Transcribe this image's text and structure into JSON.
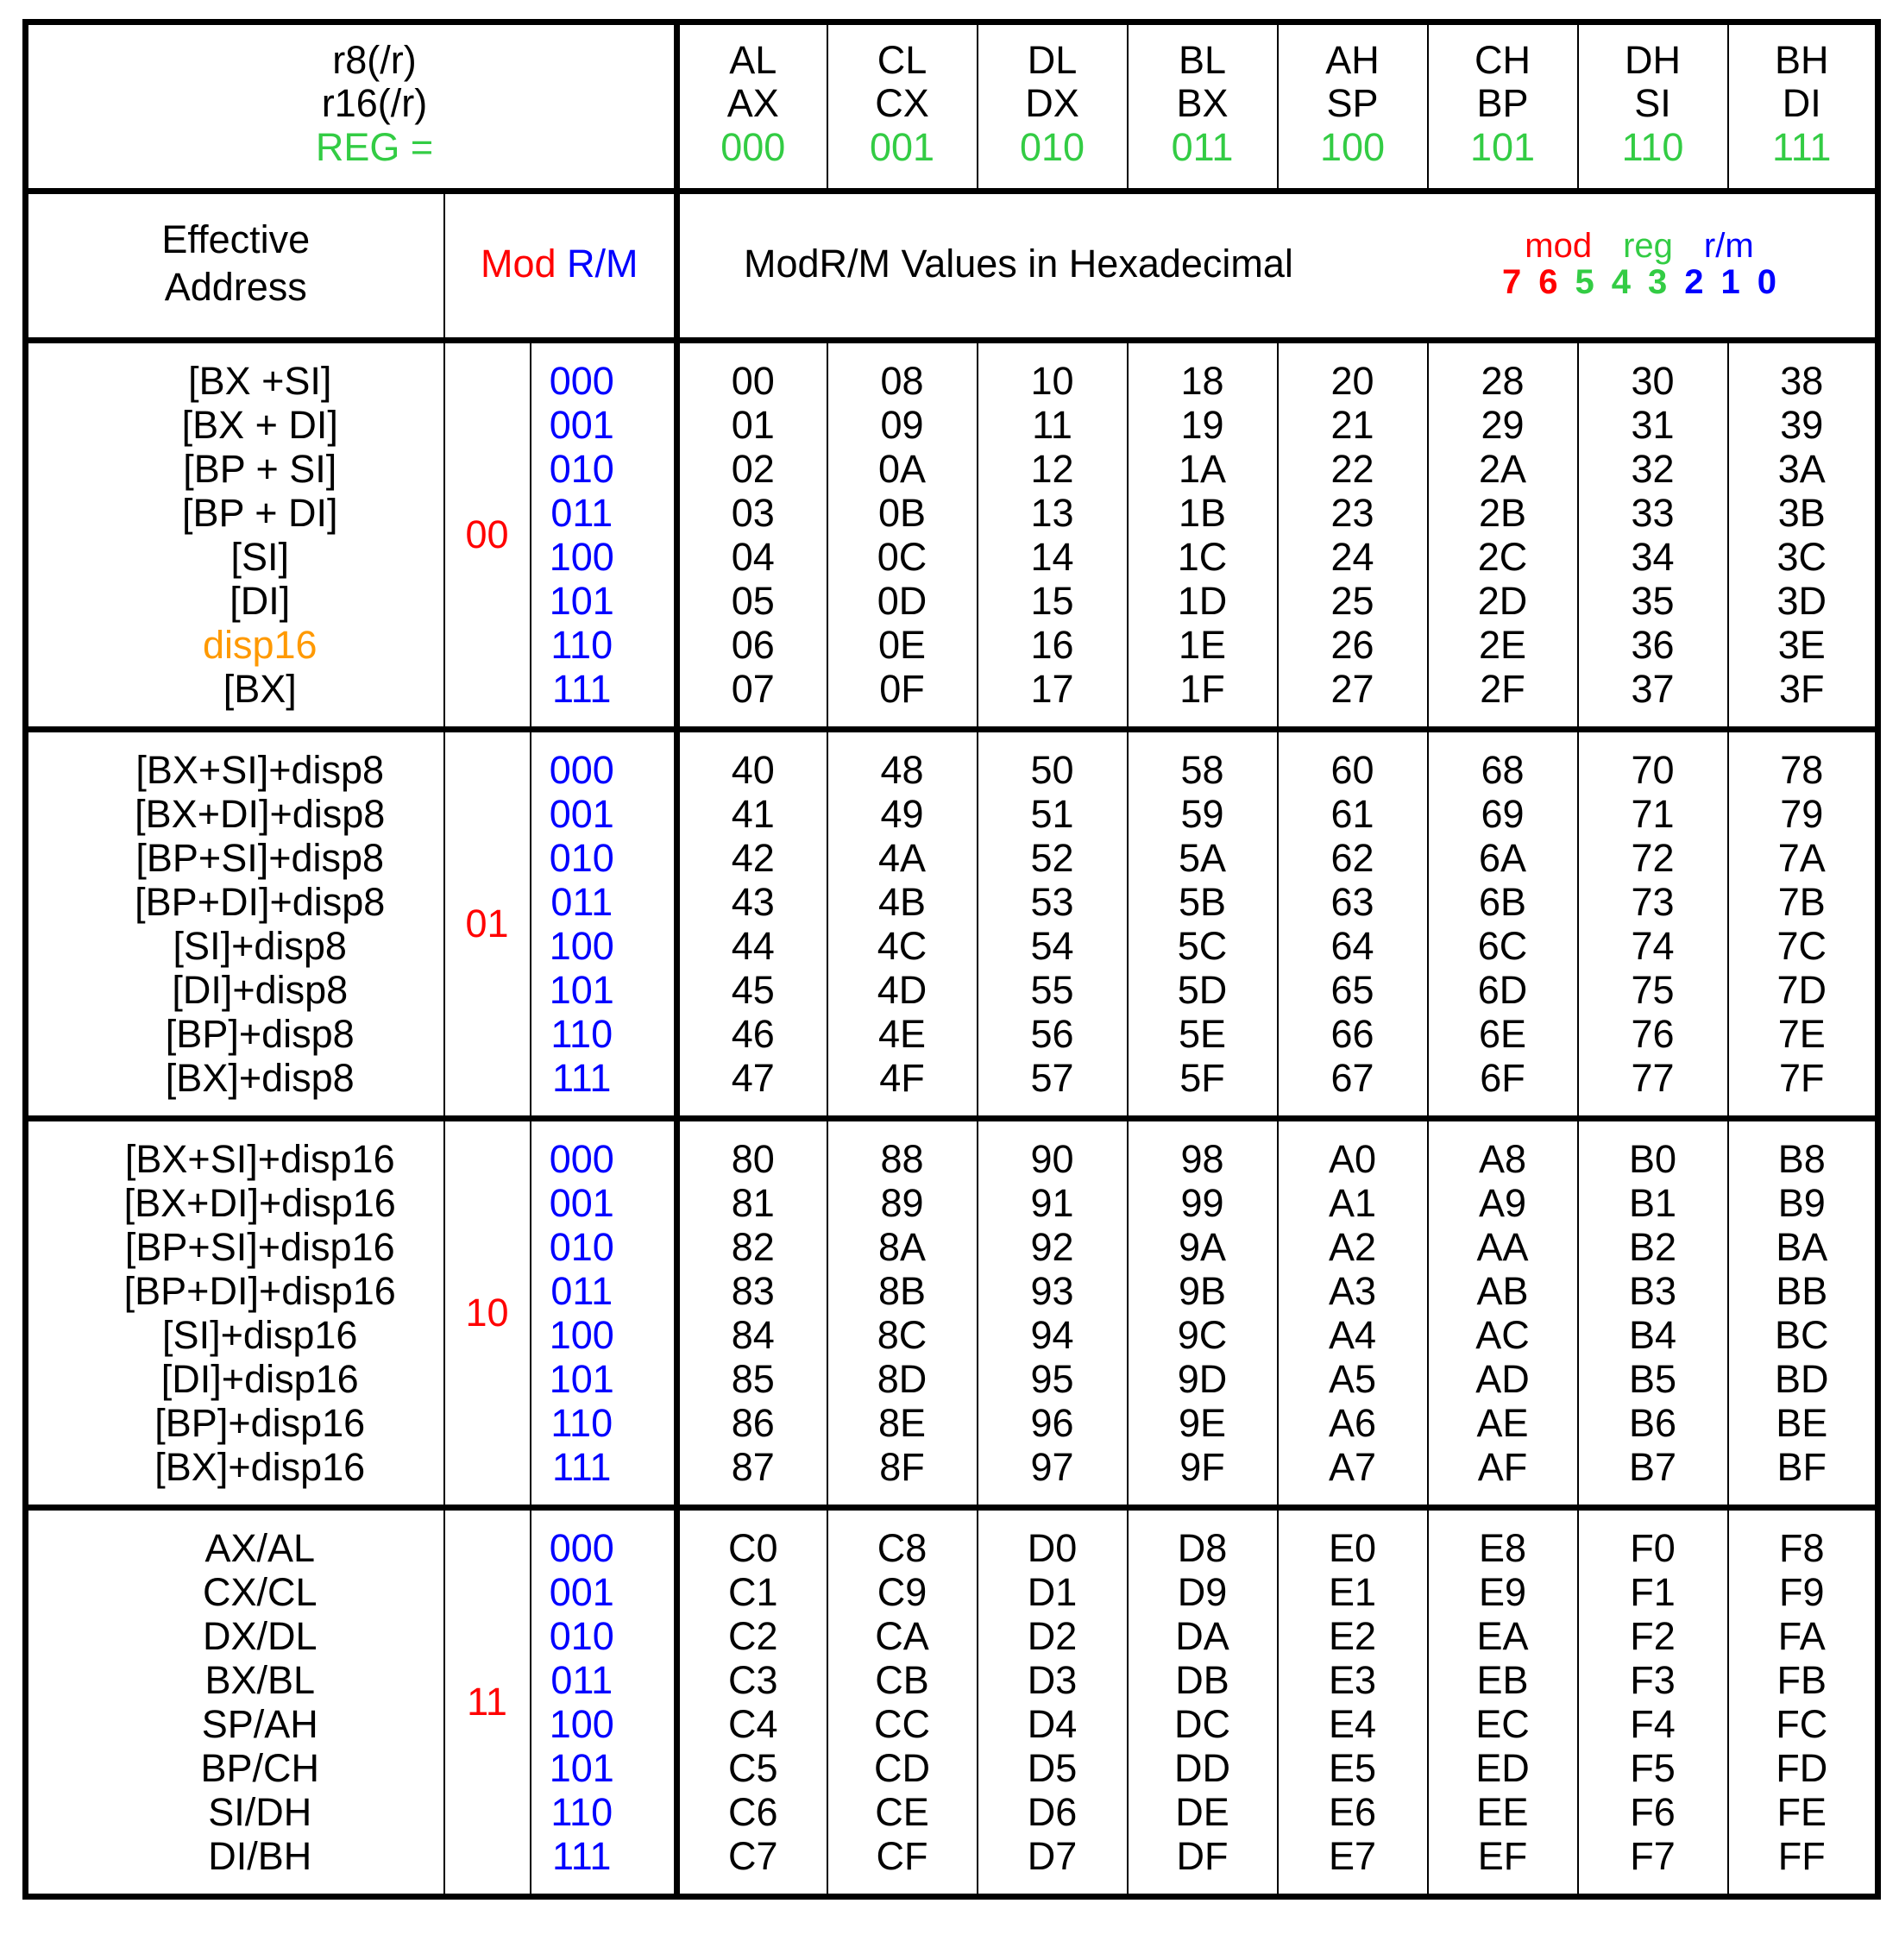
{
  "header": {
    "row_label_lines": [
      "r8(/r)",
      "r16(/r)"
    ],
    "reg_eq_label": "REG =",
    "reg_eq_color": "#33cc44",
    "columns": [
      {
        "r8": "AL",
        "r16": "AX",
        "bits": "000"
      },
      {
        "r8": "CL",
        "r16": "CX",
        "bits": "001"
      },
      {
        "r8": "DL",
        "r16": "DX",
        "bits": "010"
      },
      {
        "r8": "BL",
        "r16": "BX",
        "bits": "011"
      },
      {
        "r8": "AH",
        "r16": "SP",
        "bits": "100"
      },
      {
        "r8": "CH",
        "r16": "BP",
        "bits": "101"
      },
      {
        "r8": "DH",
        "r16": "SI",
        "bits": "110"
      },
      {
        "r8": "BH",
        "r16": "DI",
        "bits": "111"
      }
    ]
  },
  "subheader": {
    "effective_address_line1": "Effective",
    "effective_address_line2": "Address",
    "mod_label": "Mod",
    "rm_label": "R/M",
    "hex_caption": "ModR/M Values in Hexadecimal",
    "bit_legend": {
      "names": [
        "mod",
        "reg",
        "r/m"
      ],
      "bits_mod": [
        "7",
        "6"
      ],
      "bits_reg": [
        "5",
        "4",
        "3"
      ],
      "bits_rm": [
        "2",
        "1",
        "0"
      ]
    }
  },
  "colors": {
    "mod": "#ff0000",
    "reg": "#33cc44",
    "rm": "#0000ff",
    "disp16_highlight": "#ff9900",
    "rule": "#000000",
    "background": "#ffffff"
  },
  "blocks": [
    {
      "mod": "00",
      "rows": [
        {
          "ea": "[BX +SI]",
          "ea_color": "#000000",
          "rm": "000",
          "hex": [
            "00",
            "08",
            "10",
            "18",
            "20",
            "28",
            "30",
            "38"
          ]
        },
        {
          "ea": "[BX + DI]",
          "ea_color": "#000000",
          "rm": "001",
          "hex": [
            "01",
            "09",
            "11",
            "19",
            "21",
            "29",
            "31",
            "39"
          ]
        },
        {
          "ea": "[BP + SI]",
          "ea_color": "#000000",
          "rm": "010",
          "hex": [
            "02",
            "0A",
            "12",
            "1A",
            "22",
            "2A",
            "32",
            "3A"
          ]
        },
        {
          "ea": "[BP + DI]",
          "ea_color": "#000000",
          "rm": "011",
          "hex": [
            "03",
            "0B",
            "13",
            "1B",
            "23",
            "2B",
            "33",
            "3B"
          ]
        },
        {
          "ea": "[SI]",
          "ea_color": "#000000",
          "rm": "100",
          "hex": [
            "04",
            "0C",
            "14",
            "1C",
            "24",
            "2C",
            "34",
            "3C"
          ]
        },
        {
          "ea": "[DI]",
          "ea_color": "#000000",
          "rm": "101",
          "hex": [
            "05",
            "0D",
            "15",
            "1D",
            "25",
            "2D",
            "35",
            "3D"
          ]
        },
        {
          "ea": "disp16",
          "ea_color": "#ff9900",
          "rm": "110",
          "hex": [
            "06",
            "0E",
            "16",
            "1E",
            "26",
            "2E",
            "36",
            "3E"
          ]
        },
        {
          "ea": "[BX]",
          "ea_color": "#000000",
          "rm": "111",
          "hex": [
            "07",
            "0F",
            "17",
            "1F",
            "27",
            "2F",
            "37",
            "3F"
          ]
        }
      ]
    },
    {
      "mod": "01",
      "rows": [
        {
          "ea": "[BX+SI]+disp8",
          "ea_color": "#000000",
          "rm": "000",
          "hex": [
            "40",
            "48",
            "50",
            "58",
            "60",
            "68",
            "70",
            "78"
          ]
        },
        {
          "ea": "[BX+DI]+disp8",
          "ea_color": "#000000",
          "rm": "001",
          "hex": [
            "41",
            "49",
            "51",
            "59",
            "61",
            "69",
            "71",
            "79"
          ]
        },
        {
          "ea": "[BP+SI]+disp8",
          "ea_color": "#000000",
          "rm": "010",
          "hex": [
            "42",
            "4A",
            "52",
            "5A",
            "62",
            "6A",
            "72",
            "7A"
          ]
        },
        {
          "ea": "[BP+DI]+disp8",
          "ea_color": "#000000",
          "rm": "011",
          "hex": [
            "43",
            "4B",
            "53",
            "5B",
            "63",
            "6B",
            "73",
            "7B"
          ]
        },
        {
          "ea": "[SI]+disp8",
          "ea_color": "#000000",
          "rm": "100",
          "hex": [
            "44",
            "4C",
            "54",
            "5C",
            "64",
            "6C",
            "74",
            "7C"
          ]
        },
        {
          "ea": "[DI]+disp8",
          "ea_color": "#000000",
          "rm": "101",
          "hex": [
            "45",
            "4D",
            "55",
            "5D",
            "65",
            "6D",
            "75",
            "7D"
          ]
        },
        {
          "ea": "[BP]+disp8",
          "ea_color": "#000000",
          "rm": "110",
          "hex": [
            "46",
            "4E",
            "56",
            "5E",
            "66",
            "6E",
            "76",
            "7E"
          ]
        },
        {
          "ea": "[BX]+disp8",
          "ea_color": "#000000",
          "rm": "111",
          "hex": [
            "47",
            "4F",
            "57",
            "5F",
            "67",
            "6F",
            "77",
            "7F"
          ]
        }
      ]
    },
    {
      "mod": "10",
      "rows": [
        {
          "ea": "[BX+SI]+disp16",
          "ea_color": "#000000",
          "rm": "000",
          "hex": [
            "80",
            "88",
            "90",
            "98",
            "A0",
            "A8",
            "B0",
            "B8"
          ]
        },
        {
          "ea": "[BX+DI]+disp16",
          "ea_color": "#000000",
          "rm": "001",
          "hex": [
            "81",
            "89",
            "91",
            "99",
            "A1",
            "A9",
            "B1",
            "B9"
          ]
        },
        {
          "ea": "[BP+SI]+disp16",
          "ea_color": "#000000",
          "rm": "010",
          "hex": [
            "82",
            "8A",
            "92",
            "9A",
            "A2",
            "AA",
            "B2",
            "BA"
          ]
        },
        {
          "ea": "[BP+DI]+disp16",
          "ea_color": "#000000",
          "rm": "011",
          "hex": [
            "83",
            "8B",
            "93",
            "9B",
            "A3",
            "AB",
            "B3",
            "BB"
          ]
        },
        {
          "ea": "[SI]+disp16",
          "ea_color": "#000000",
          "rm": "100",
          "hex": [
            "84",
            "8C",
            "94",
            "9C",
            "A4",
            "AC",
            "B4",
            "BC"
          ]
        },
        {
          "ea": "[DI]+disp16",
          "ea_color": "#000000",
          "rm": "101",
          "hex": [
            "85",
            "8D",
            "95",
            "9D",
            "A5",
            "AD",
            "B5",
            "BD"
          ]
        },
        {
          "ea": "[BP]+disp16",
          "ea_color": "#000000",
          "rm": "110",
          "hex": [
            "86",
            "8E",
            "96",
            "9E",
            "A6",
            "AE",
            "B6",
            "BE"
          ]
        },
        {
          "ea": "[BX]+disp16",
          "ea_color": "#000000",
          "rm": "111",
          "hex": [
            "87",
            "8F",
            "97",
            "9F",
            "A7",
            "AF",
            "B7",
            "BF"
          ]
        }
      ]
    },
    {
      "mod": "11",
      "rows": [
        {
          "ea": "AX/AL",
          "ea_color": "#000000",
          "rm": "000",
          "hex": [
            "C0",
            "C8",
            "D0",
            "D8",
            "E0",
            "E8",
            "F0",
            "F8"
          ]
        },
        {
          "ea": "CX/CL",
          "ea_color": "#000000",
          "rm": "001",
          "hex": [
            "C1",
            "C9",
            "D1",
            "D9",
            "E1",
            "E9",
            "F1",
            "F9"
          ]
        },
        {
          "ea": "DX/DL",
          "ea_color": "#000000",
          "rm": "010",
          "hex": [
            "C2",
            "CA",
            "D2",
            "DA",
            "E2",
            "EA",
            "F2",
            "FA"
          ]
        },
        {
          "ea": "BX/BL",
          "ea_color": "#000000",
          "rm": "011",
          "hex": [
            "C3",
            "CB",
            "D3",
            "DB",
            "E3",
            "EB",
            "F3",
            "FB"
          ]
        },
        {
          "ea": "SP/AH",
          "ea_color": "#000000",
          "rm": "100",
          "hex": [
            "C4",
            "CC",
            "D4",
            "DC",
            "E4",
            "EC",
            "F4",
            "FC"
          ]
        },
        {
          "ea": "BP/CH",
          "ea_color": "#000000",
          "rm": "101",
          "hex": [
            "C5",
            "CD",
            "D5",
            "DD",
            "E5",
            "ED",
            "F5",
            "FD"
          ]
        },
        {
          "ea": "SI/DH",
          "ea_color": "#000000",
          "rm": "110",
          "hex": [
            "C6",
            "CE",
            "D6",
            "DE",
            "E6",
            "EE",
            "F6",
            "FE"
          ]
        },
        {
          "ea": "DI/BH",
          "ea_color": "#000000",
          "rm": "111",
          "hex": [
            "C7",
            "CF",
            "D7",
            "DF",
            "E7",
            "EF",
            "F7",
            "FF"
          ]
        }
      ]
    }
  ]
}
